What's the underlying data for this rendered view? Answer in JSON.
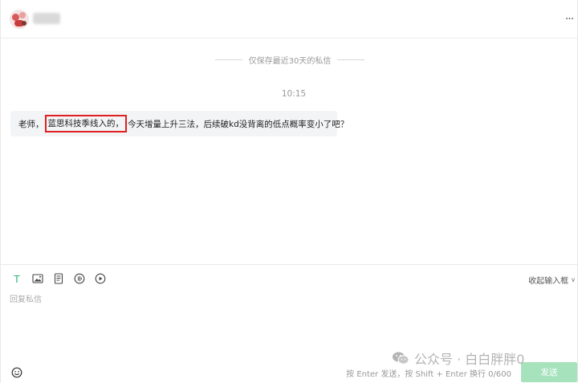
{
  "header": {
    "avatar_icon": "avatar-icon",
    "more_icon": "more-dots-icon",
    "more_glyph": "···"
  },
  "messages": {
    "retention_notice": "仅保存最近30天的私信",
    "timestamp": "10:15",
    "bubble": {
      "before": "老师，",
      "highlighted": "蓝思科技季线入的，",
      "after": "今天增量上升三法，后续破kd没背离的低点概率变小了吧？"
    },
    "highlight_color": "#e02020"
  },
  "composer": {
    "toolbar_icons": [
      "text-icon",
      "image-icon",
      "document-icon",
      "audio-icon",
      "video-icon"
    ],
    "text_tool_glyph": "T",
    "collapse_label": "收起输入框",
    "collapse_chevron": "∨",
    "input_placeholder": "回复私信",
    "emoji_icon": "emoji-icon",
    "hint": "按 Enter 发送，按 Shift + Enter 换行  0/600",
    "send_label": "发送",
    "send_color": "#a6e3bd",
    "accent_color": "#2bb673"
  },
  "watermark": {
    "text": "公众号 · 白白胖胖0",
    "icon": "wechat-icon"
  }
}
